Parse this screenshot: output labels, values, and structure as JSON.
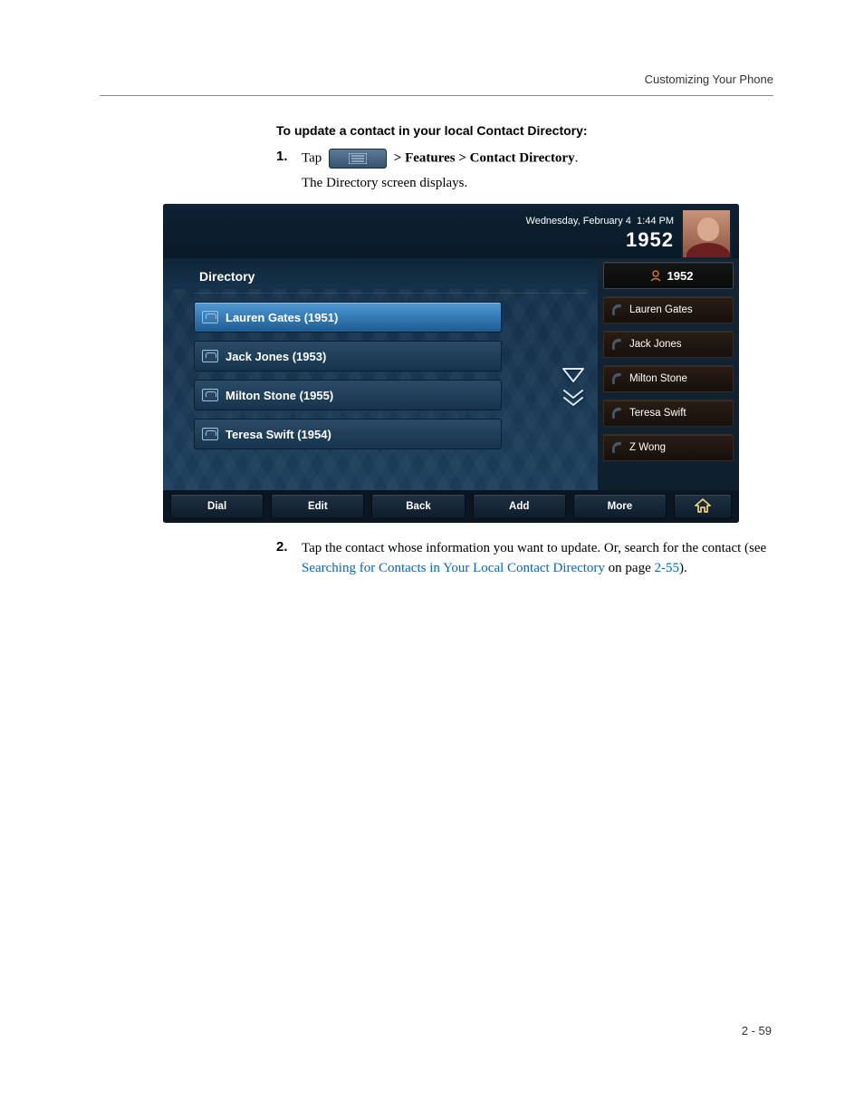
{
  "header": {
    "section": "Customizing Your Phone"
  },
  "title": "To update a contact in your local Contact Directory:",
  "step1": {
    "num": "1.",
    "lead": "Tap",
    "menu_icon": "menu-icon",
    "gt1": "> Features > Contact Directory",
    "trail": ".",
    "sub": "The Directory screen displays."
  },
  "phone": {
    "date": "Wednesday, February 4",
    "time": "1:44 PM",
    "ext": "1952",
    "avatar": "user-avatar",
    "dir_title": "Directory",
    "contacts": [
      {
        "label": "Lauren Gates (1951)",
        "selected": true
      },
      {
        "label": "Jack Jones (1953)",
        "selected": false
      },
      {
        "label": "Milton Stone (1955)",
        "selected": false
      },
      {
        "label": "Teresa Swift (1954)",
        "selected": false
      }
    ],
    "scroll_arrows": [
      "down",
      "down"
    ],
    "sidebar": [
      {
        "label": "1952",
        "first": true
      },
      {
        "label": "Lauren Gates"
      },
      {
        "label": "Jack Jones"
      },
      {
        "label": "Milton Stone"
      },
      {
        "label": "Teresa Swift"
      },
      {
        "label": "Z Wong"
      }
    ],
    "softkeys": [
      "Dial",
      "Edit",
      "Back",
      "Add",
      "More"
    ],
    "home_icon": "home-icon"
  },
  "step2": {
    "num": "2.",
    "text_a": "Tap the contact whose information you want to update. Or, search for the contact (see ",
    "link": "Searching for Contacts in Your Local Contact Directory",
    "text_b": " on page ",
    "page_ref": "2-55",
    "text_c": ")."
  },
  "footer": {
    "page": "2 - 59"
  }
}
